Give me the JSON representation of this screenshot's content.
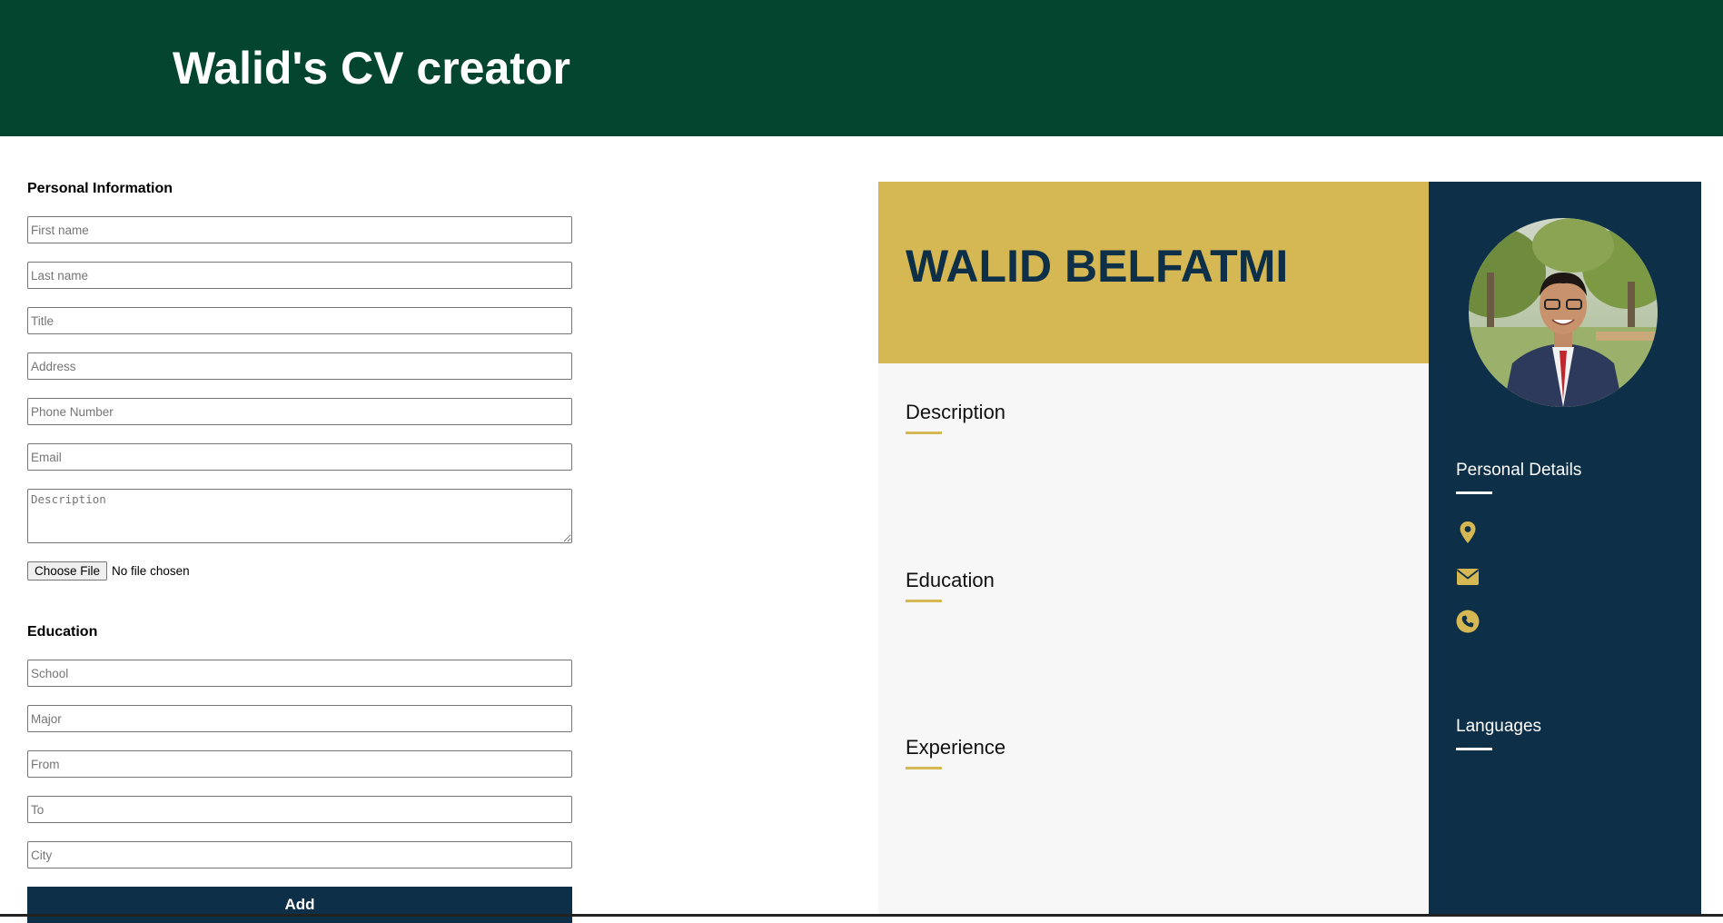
{
  "header": {
    "title": "Walid's CV creator"
  },
  "form": {
    "personal": {
      "heading": "Personal Information",
      "first_name_placeholder": "First name",
      "last_name_placeholder": "Last name",
      "title_placeholder": "Title",
      "address_placeholder": "Address",
      "phone_placeholder": "Phone Number",
      "email_placeholder": "Email",
      "description_placeholder": "Description",
      "file_button_label": "Choose File",
      "file_status": "No file chosen"
    },
    "education": {
      "heading": "Education",
      "school_placeholder": "School",
      "major_placeholder": "Major",
      "from_placeholder": "From",
      "to_placeholder": "To",
      "city_placeholder": "City",
      "add_label": "Add"
    }
  },
  "cv": {
    "name": "WALID BELFATMI",
    "sections": {
      "description": "Description",
      "education": "Education",
      "experience": "Experience"
    },
    "sidebar": {
      "personal_details": "Personal Details",
      "languages": "Languages",
      "icons": [
        "location-pin-icon",
        "envelope-icon",
        "phone-icon"
      ]
    }
  },
  "colors": {
    "header_bg": "#03452e",
    "gold": "#d5b853",
    "navy": "#0e2f48"
  }
}
